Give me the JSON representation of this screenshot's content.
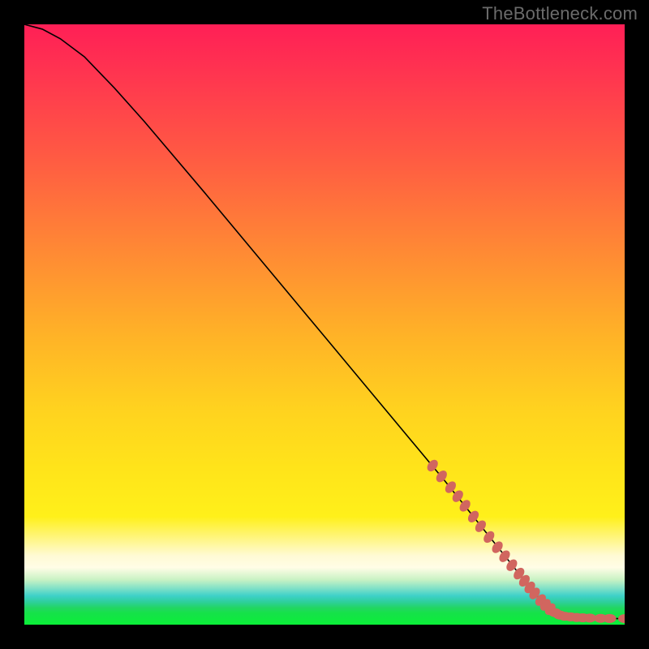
{
  "watermark": "TheBottleneck.com",
  "colors": {
    "background": "#000000",
    "curve": "#000000",
    "marker": "#d1665f"
  },
  "chart_data": {
    "type": "line",
    "title": "",
    "xlabel": "",
    "ylabel": "",
    "xlim": [
      0,
      100
    ],
    "ylim": [
      0,
      100
    ],
    "grid": false,
    "legend": false,
    "series": [
      {
        "name": "bottleneck-curve",
        "x": [
          0,
          3,
          6,
          10,
          15,
          20,
          30,
          40,
          50,
          60,
          70,
          78,
          82,
          85,
          87,
          88,
          89,
          90,
          92,
          94,
          96,
          98,
          100
        ],
        "y": [
          100,
          99.2,
          97.6,
          94.6,
          89.4,
          83.8,
          72.0,
          60.0,
          48.0,
          36.0,
          24.0,
          14.0,
          9.0,
          5.2,
          3.2,
          2.4,
          1.8,
          1.4,
          1.2,
          1.1,
          1.05,
          1.02,
          1.0
        ]
      }
    ],
    "markers": {
      "description": "Highlighted data points along the curve and along the bottom plateau",
      "points": [
        {
          "x": 68.0,
          "y": 26.5
        },
        {
          "x": 69.5,
          "y": 24.7
        },
        {
          "x": 71.0,
          "y": 22.9
        },
        {
          "x": 72.2,
          "y": 21.4
        },
        {
          "x": 73.4,
          "y": 19.8
        },
        {
          "x": 74.8,
          "y": 18.0
        },
        {
          "x": 76.0,
          "y": 16.4
        },
        {
          "x": 77.4,
          "y": 14.6
        },
        {
          "x": 78.8,
          "y": 12.9
        },
        {
          "x": 80.0,
          "y": 11.4
        },
        {
          "x": 81.2,
          "y": 9.9
        },
        {
          "x": 82.4,
          "y": 8.5
        },
        {
          "x": 83.3,
          "y": 7.3
        },
        {
          "x": 84.2,
          "y": 6.2
        },
        {
          "x": 85.0,
          "y": 5.2
        },
        {
          "x": 86.0,
          "y": 4.1
        },
        {
          "x": 86.8,
          "y": 3.3
        },
        {
          "x": 87.6,
          "y": 2.6
        },
        {
          "x": 88.4,
          "y": 2.0
        },
        {
          "x": 89.2,
          "y": 1.6
        },
        {
          "x": 90.0,
          "y": 1.4
        },
        {
          "x": 91.0,
          "y": 1.3
        },
        {
          "x": 92.0,
          "y": 1.2
        },
        {
          "x": 93.0,
          "y": 1.15
        },
        {
          "x": 94.2,
          "y": 1.1
        },
        {
          "x": 96.0,
          "y": 1.05
        },
        {
          "x": 97.5,
          "y": 1.03
        },
        {
          "x": 100.0,
          "y": 1.0
        }
      ]
    }
  }
}
